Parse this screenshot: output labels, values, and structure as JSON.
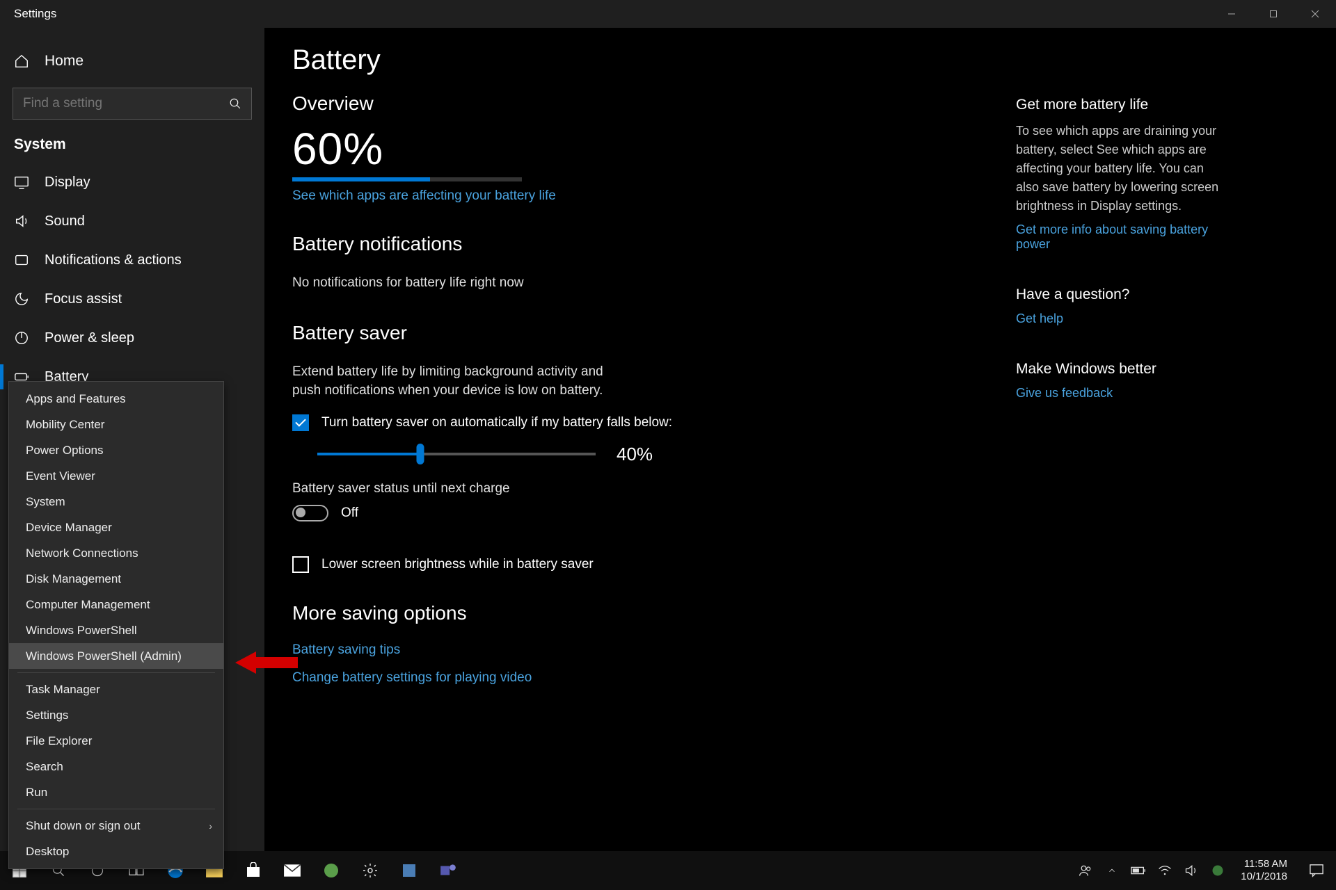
{
  "window": {
    "title": "Settings"
  },
  "sidebar": {
    "home": "Home",
    "search_placeholder": "Find a setting",
    "section": "System",
    "items": [
      {
        "label": "Display"
      },
      {
        "label": "Sound"
      },
      {
        "label": "Notifications & actions"
      },
      {
        "label": "Focus assist"
      },
      {
        "label": "Power & sleep"
      },
      {
        "label": "Battery",
        "active": true
      }
    ]
  },
  "main": {
    "title": "Battery",
    "overview": {
      "heading": "Overview",
      "percent": "60%",
      "percent_value": 60,
      "link": "See which apps are affecting your battery life"
    },
    "notifications": {
      "heading": "Battery notifications",
      "text": "No notifications for battery life right now"
    },
    "saver": {
      "heading": "Battery saver",
      "desc": "Extend battery life by limiting background activity and push notifications when your device is low on battery.",
      "auto_checkbox": "Turn battery saver on automatically if my battery falls below:",
      "slider_value": 40,
      "slider_label": "40%",
      "status_label": "Battery saver status until next charge",
      "toggle_state": "Off",
      "brightness_checkbox": "Lower screen brightness while in battery saver"
    },
    "more": {
      "heading": "More saving options",
      "link1": "Battery saving tips",
      "link2": "Change battery settings for playing video"
    }
  },
  "right": {
    "block1": {
      "heading": "Get more battery life",
      "text": "To see which apps are draining your battery, select See which apps are affecting your battery life. You can also save battery by lowering screen brightness in Display settings.",
      "link": "Get more info about saving battery power"
    },
    "block2": {
      "heading": "Have a question?",
      "link": "Get help"
    },
    "block3": {
      "heading": "Make Windows better",
      "link": "Give us feedback"
    }
  },
  "context_menu": {
    "items": [
      "Apps and Features",
      "Mobility Center",
      "Power Options",
      "Event Viewer",
      "System",
      "Device Manager",
      "Network Connections",
      "Disk Management",
      "Computer Management",
      "Windows PowerShell",
      "Windows PowerShell (Admin)"
    ],
    "highlighted": "Windows PowerShell (Admin)",
    "items2": [
      "Task Manager",
      "Settings",
      "File Explorer",
      "Search",
      "Run"
    ],
    "items3": [
      {
        "label": "Shut down or sign out",
        "submenu": true
      },
      {
        "label": "Desktop"
      }
    ]
  },
  "taskbar": {
    "time": "11:58 AM",
    "date": "10/1/2018"
  }
}
